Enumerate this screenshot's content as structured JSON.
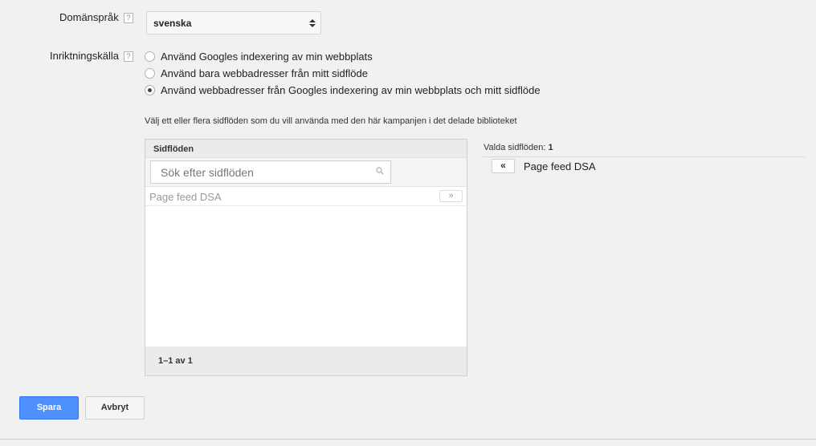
{
  "domain_language": {
    "label": "Domänspråk",
    "help": "?",
    "selected": "svenska"
  },
  "targeting_source": {
    "label": "Inriktningskälla",
    "help": "?",
    "options": [
      {
        "label": "Använd Googles indexering av min webbplats",
        "checked": false
      },
      {
        "label": "Använd bara webbadresser från mitt sidflöde",
        "checked": false
      },
      {
        "label": "Använd webbadresser från Googles indexering av min webbplats och mitt sidflöde",
        "checked": true
      }
    ]
  },
  "instruction": "Välj ett eller flera sidflöden som du vill använda med den här kampanjen i det delade biblioteket",
  "feeds_panel": {
    "header": "Sidflöden",
    "search_placeholder": "Sök efter sidflöden",
    "items": [
      {
        "name": "Page feed DSA",
        "add_label": "»"
      }
    ],
    "footer": "1–1 av 1"
  },
  "selected_panel": {
    "title_prefix": "Valda sidflöden: ",
    "count": "1",
    "items": [
      {
        "name": "Page feed DSA",
        "remove_label": "«"
      }
    ]
  },
  "buttons": {
    "save": "Spara",
    "cancel": "Avbryt"
  },
  "colors": {
    "primary": "#4d90fe",
    "background": "#f1f1f1"
  }
}
